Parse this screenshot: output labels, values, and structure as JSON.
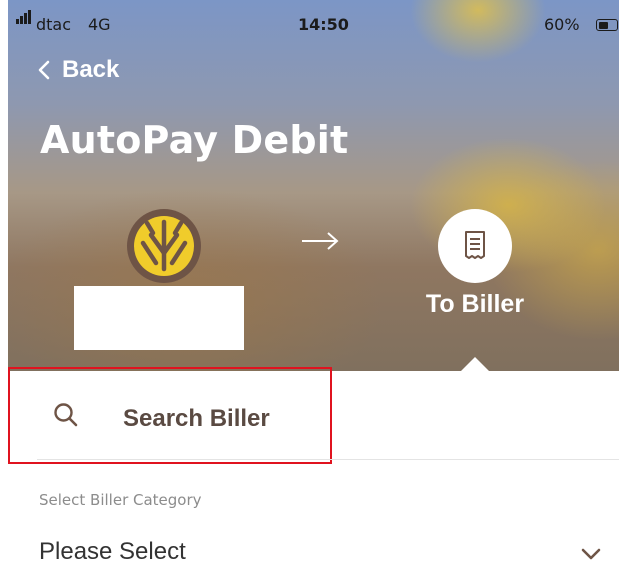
{
  "status_bar": {
    "carrier": "dtac",
    "network": "4G",
    "time": "14:50",
    "battery_percent": "60%",
    "battery_level": 0.6
  },
  "nav": {
    "back_label": "Back",
    "back_icon": "chevron-left-icon"
  },
  "page": {
    "title": "AutoPay Debit"
  },
  "flow": {
    "source_logo": "bank-logo",
    "arrow_icon": "arrow-right-icon",
    "biller_icon": "receipt-icon",
    "biller_label": "To Biller"
  },
  "search": {
    "label": "Search Biller",
    "icon": "search-icon"
  },
  "category": {
    "label": "Select Biller Category",
    "selected": "Please Select",
    "icon": "chevron-down-icon"
  },
  "colors": {
    "highlight_border": "#e0131f",
    "logo_gold": "#f0cc2b",
    "logo_brown": "#6e5446"
  }
}
